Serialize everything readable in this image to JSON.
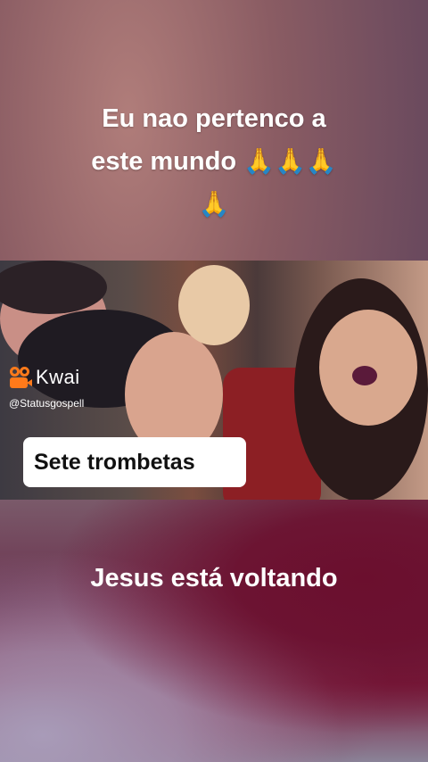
{
  "overlay_top": {
    "line1": "Eu nao pertenco a",
    "line2": "este mundo",
    "emoji_line2": "🙏🙏🙏",
    "emoji_line3": "🙏"
  },
  "video": {
    "kwai_brand": "Kwai",
    "kwai_handle": "@Statusgospell",
    "caption": "Sete trombetas"
  },
  "overlay_bottom": {
    "text": "Jesus está voltando"
  },
  "colors": {
    "kwai_accent": "#ff7a1a",
    "caption_bg": "#ffffff"
  }
}
